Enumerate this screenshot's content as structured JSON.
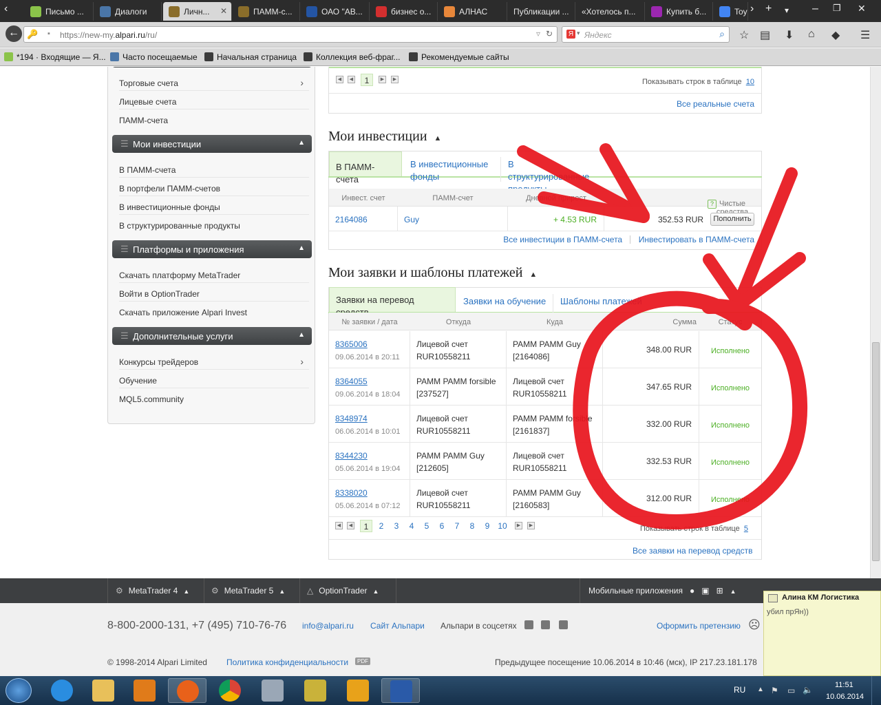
{
  "browser": {
    "tabs": [
      {
        "label": "Письмо ...",
        "color": "#8bc34a"
      },
      {
        "label": "Диалоги",
        "color": "#4a76a8"
      },
      {
        "label": "Личн...",
        "color": "#8a6d2a",
        "active": true
      },
      {
        "label": "ПАММ-с...",
        "color": "#8a6d2a"
      },
      {
        "label": "ОАО \"АВ...",
        "color": "#2455a4"
      },
      {
        "label": "бизнес о...",
        "color": "#d32f2f"
      },
      {
        "label": "АЛНАС",
        "color": "#e8873a"
      },
      {
        "label": "Публикации ...",
        "color": "#2c2c2c"
      },
      {
        "label": "«Хотелось п...",
        "color": "#2c2c2c"
      },
      {
        "label": "Купить б...",
        "color": "#9c27b0"
      },
      {
        "label": "Toy",
        "color": "#4285f4"
      }
    ],
    "url_prefix": "https://new-my.",
    "url_domain": "alpari.ru",
    "url_suffix": "/ru/",
    "search_placeholder": "Яндекс",
    "bookmarks": [
      "*194 · Входящие — Я...",
      "Часто посещаемые",
      "Начальная страница",
      "Коллекция веб-фраг...",
      "Рекомендуемые сайты"
    ]
  },
  "sidebar": {
    "top_items": [
      "Торговые счета",
      "Лицевые счета",
      "ПАММ-счета"
    ],
    "sections": [
      {
        "title": "Мои инвестиции",
        "items": [
          "В ПАММ-счета",
          "В портфели ПАММ-счетов",
          "В инвестиционные фонды",
          "В структурированные продукты"
        ]
      },
      {
        "title": "Платформы и приложения",
        "items": [
          "Скачать платформу MetaTrader",
          "Войти в OptionTrader",
          "Скачать приложение Alpari Invest"
        ]
      },
      {
        "title": "Дополнительные услуги",
        "items": [
          "Конкурсы трейдеров",
          "Обучение",
          "MQL5.community"
        ]
      }
    ]
  },
  "accounts": {
    "rows_label": "Показывать строк в таблице",
    "rows_value": "10",
    "page": "1",
    "all_link": "Все реальные счета"
  },
  "investments": {
    "title": "Мои инвестиции",
    "tabs": [
      "В ПАММ-счета",
      "В инвестиционные фонды",
      "В структурированные продукты"
    ],
    "columns": [
      "Инвест. счет",
      "ПАММ-счет",
      "Дневной прирост",
      "Чистые средства"
    ],
    "row": {
      "account": "2164086",
      "pamm": "Guy",
      "gain": "+ 4.53 RUR",
      "net": "352.53 RUR",
      "button": "Пополнить"
    },
    "link_all": "Все инвестиции в ПАММ-счета",
    "link_invest": "Инвестировать в ПАММ-счета"
  },
  "requests": {
    "title": "Мои заявки и шаблоны платежей",
    "tabs": [
      "Заявки на перевод средств",
      "Заявки на обучение",
      "Шаблоны платежей"
    ],
    "columns": [
      "№ заявки / дата",
      "Откуда",
      "Куда",
      "Сумма",
      "Статус"
    ],
    "rows": [
      {
        "id": "8365006",
        "date": "09.06.2014 в 20:11",
        "from1": "Лицевой счет",
        "from2": "RUR10558211",
        "to1": "PAMM PAMM Guy",
        "to2": "[2164086]",
        "sum": "348.00 RUR",
        "status": "Исполнено"
      },
      {
        "id": "8364055",
        "date": "09.06.2014 в 18:04",
        "from1": "PAMM PAMM forsible",
        "from2": "[237527]",
        "to1": "Лицевой счет",
        "to2": "RUR10558211",
        "sum": "347.65 RUR",
        "status": "Исполнено"
      },
      {
        "id": "8348974",
        "date": "06.06.2014 в 10:01",
        "from1": "Лицевой счет",
        "from2": "RUR10558211",
        "to1": "PAMM PAMM forsible",
        "to2": "[2161837]",
        "sum": "332.00 RUR",
        "status": "Исполнено"
      },
      {
        "id": "8344230",
        "date": "05.06.2014 в 19:04",
        "from1": "PAMM PAMM Guy",
        "from2": "[212605]",
        "to1": "Лицевой счет",
        "to2": "RUR10558211",
        "sum": "332.53 RUR",
        "status": "Исполнено"
      },
      {
        "id": "8338020",
        "date": "05.06.2014 в 07:12",
        "from1": "Лицевой счет",
        "from2": "RUR10558211",
        "to1": "PAMM PAMM Guy",
        "to2": "[2160583]",
        "sum": "312.00 RUR",
        "status": "Исполнено"
      }
    ],
    "pages": [
      "1",
      "2",
      "3",
      "4",
      "5",
      "6",
      "7",
      "8",
      "9",
      "10"
    ],
    "rows_label": "Показывать строк в таблице",
    "rows_value": "5",
    "link_all": "Все заявки на перевод средств"
  },
  "footer_bar": {
    "items": [
      "MetaTrader 4",
      "MetaTrader 5",
      "OptionTrader"
    ],
    "mobile": "Мобильные приложения"
  },
  "footer": {
    "phones": "8-800-2000-131, +7 (495) 710-76-76",
    "email": "info@alpari.ru",
    "site": "Сайт Альпари",
    "social": "Альпари в соцсетях",
    "claim": "Оформить претензию",
    "copyright": "© 1998-2014 Alpari Limited",
    "privacy": "Политика конфиденциальности",
    "pdf": "PDF",
    "last_visit": "Предыдущее посещение 10.06.2014 в 10:46 (мск), IP 217.23.181.178"
  },
  "chat": {
    "sender": "Алина КМ Логистика",
    "message": "убил прЯн))"
  },
  "taskbar": {
    "lang": "RU",
    "time": "11:51",
    "date": "10.06.2014"
  },
  "colors": {
    "accent_link": "#2a72c0",
    "success": "#4caf24",
    "annotation": "#e8141c"
  }
}
